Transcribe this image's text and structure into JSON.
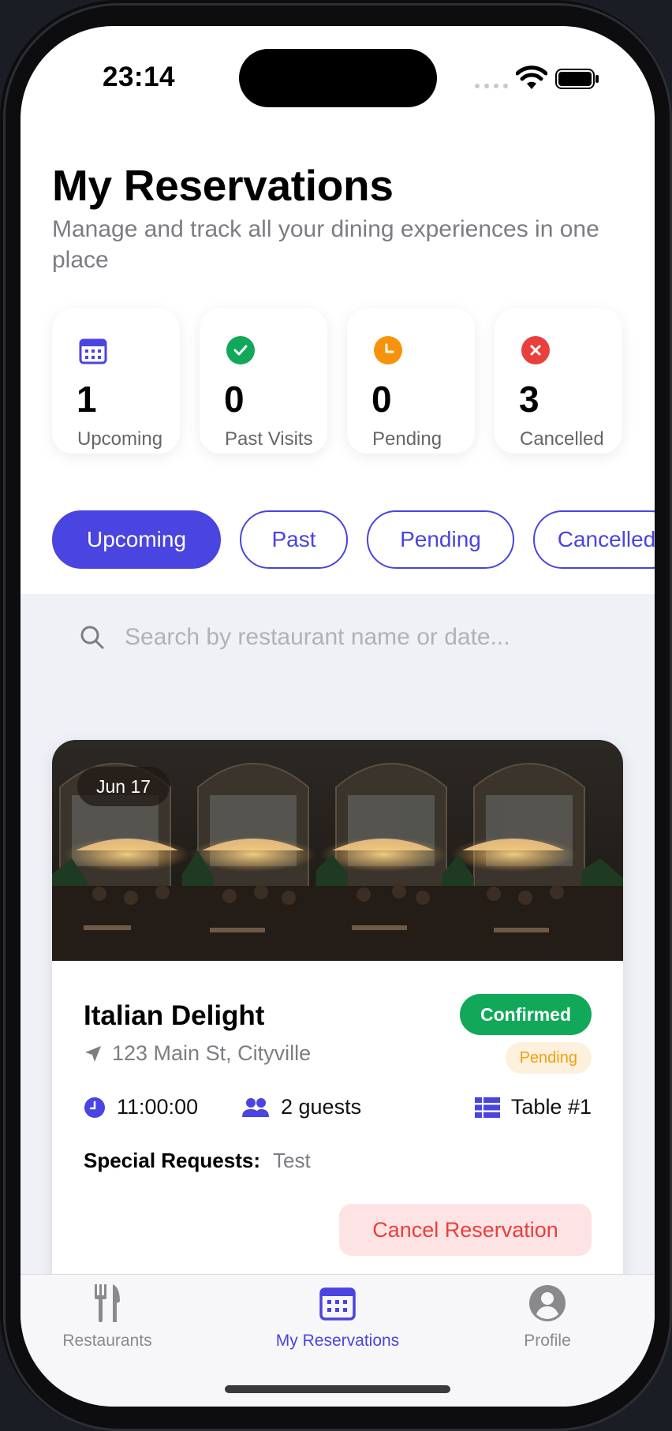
{
  "status_bar": {
    "time": "23:14"
  },
  "header": {
    "title": "My Reservations",
    "subtitle": "Manage and track all your dining experiences in one place"
  },
  "stats": [
    {
      "value": "1",
      "label": "Upcoming",
      "icon": "calendar-icon",
      "color": "#4a44e0"
    },
    {
      "value": "0",
      "label": "Past Visits",
      "icon": "checkmark-icon",
      "color": "#12a85a"
    },
    {
      "value": "0",
      "label": "Pending",
      "icon": "clock-icon",
      "color": "#f7930a"
    },
    {
      "value": "3",
      "label": "Cancelled",
      "icon": "x-circle-icon",
      "color": "#e8403c"
    }
  ],
  "filter_tabs": [
    {
      "label": "Upcoming",
      "active": true
    },
    {
      "label": "Past",
      "active": false
    },
    {
      "label": "Pending",
      "active": false
    },
    {
      "label": "Cancelled",
      "active": false
    }
  ],
  "search": {
    "placeholder": "Search by restaurant name or date..."
  },
  "reservation": {
    "date": "Jun 17",
    "restaurant": "Italian Delight",
    "address": "123 Main St, Cityville",
    "status": "Confirmed",
    "payment_status": "Pending",
    "time": "11:00:00",
    "guests": "2 guests",
    "table": "Table #1",
    "special_requests_label": "Special Requests:",
    "special_requests": "Test",
    "cancel_label": "Cancel Reservation",
    "image_description_icon": "restaurant-photo"
  },
  "tab_bar": [
    {
      "label": "Restaurants",
      "icon": "fork-knife-icon",
      "active": false
    },
    {
      "label": "My Reservations",
      "icon": "calendar-icon",
      "active": true
    },
    {
      "label": "Profile",
      "icon": "person-circle-icon",
      "active": false
    }
  ],
  "colors": {
    "accent": "#4a44e0",
    "confirmed": "#12a85a",
    "pending": "#f29f0d",
    "danger": "#e8403c"
  }
}
